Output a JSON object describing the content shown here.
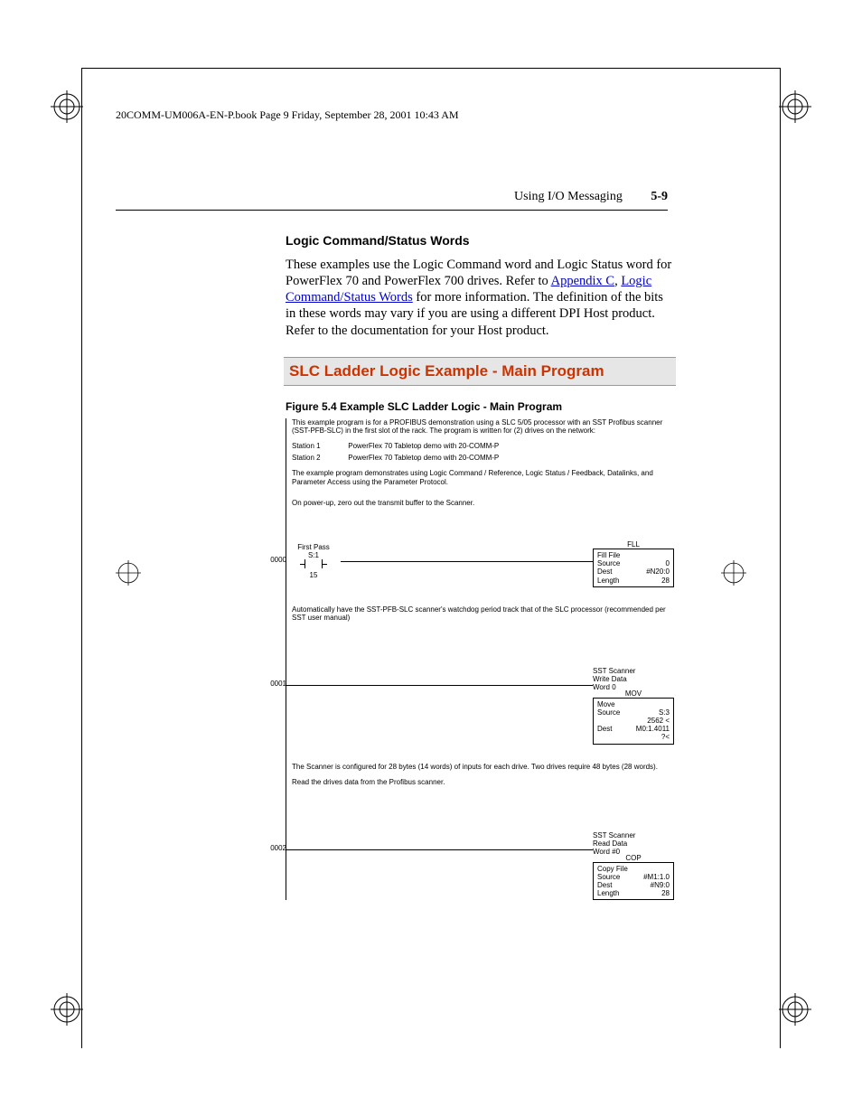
{
  "header_line": "20COMM-UM006A-EN-P.book  Page 9  Friday, September 28, 2001  10:43 AM",
  "running_head": {
    "title": "Using I/O Messaging",
    "page": "5-9"
  },
  "subhead": "Logic Command/Status Words",
  "para1_a": "These examples use the Logic Command word and Logic Status word for PowerFlex 70 and PowerFlex 700 drives. Refer to ",
  "link1": "Appendix C",
  "para1_b": ", ",
  "link2": "Logic Command/Status Words",
  "para1_c": " for more information. The definition of the bits in these words may vary if you are using a different DPI Host product. Refer to the documentation for your Host product.",
  "section_title": "SLC Ladder Logic Example - Main Program",
  "fig_caption": "Figure 5.4   Example SLC Ladder Logic - Main Program",
  "ladder": {
    "intro1": "This example program is for a PROFIBUS demonstration using a SLC 5/05 processor with an SST Profibus scanner (SST-PFB-SLC) in the first slot of the rack.  The program is written for (2) drives on the network:",
    "stations": [
      {
        "label": "Station 1",
        "desc": "PowerFlex 70 Tabletop demo with 20-COMM-P"
      },
      {
        "label": "Station 2",
        "desc": "PowerFlex 70 Tabletop demo with 20-COMM-P"
      }
    ],
    "intro2": "The example program demonstrates using Logic Command / Reference, Logic Status / Feedback, Datalinks, and Parameter Access using the Parameter Protocol.",
    "intro3": "On power-up, zero out the transmit buffer to the Scanner.",
    "rung0": {
      "num": "0000",
      "contact_label": "First Pass",
      "contact_addr": "S:1",
      "contact_bit": "15",
      "inst_name": "FLL",
      "inst_title": "Fill File",
      "rows": [
        {
          "k": "Source",
          "v": "0"
        },
        {
          "k": "Dest",
          "v": "#N20:0"
        },
        {
          "k": "Length",
          "v": "28"
        }
      ]
    },
    "note1": "Automatically have the SST-PFB-SLC scanner's watchdog period track that of the SLC processor (recommended per SST user manual)",
    "rung1": {
      "num": "0001",
      "above": "SST Scanner\nWrite Data\nWord 0",
      "inst_name": "MOV",
      "inst_title": "Move",
      "rows": [
        {
          "k": "Source",
          "v": "S:3"
        },
        {
          "k": "",
          "v": "2562 <"
        },
        {
          "k": "Dest",
          "v": "M0:1.4011"
        },
        {
          "k": "",
          "v": "?<"
        }
      ]
    },
    "note2": "The Scanner is configured for 28 bytes (14 words) of inputs for each drive.  Two drives require 48 bytes (28 words).",
    "note3": "Read the drives data from the Profibus scanner.",
    "rung2": {
      "num": "0002",
      "above": "SST Scanner\nRead Data\nWord #0",
      "inst_name": "COP",
      "inst_title": "Copy File",
      "rows": [
        {
          "k": "Source",
          "v": "#M1:1.0"
        },
        {
          "k": "Dest",
          "v": "#N9:0"
        },
        {
          "k": "Length",
          "v": "28"
        }
      ]
    }
  }
}
